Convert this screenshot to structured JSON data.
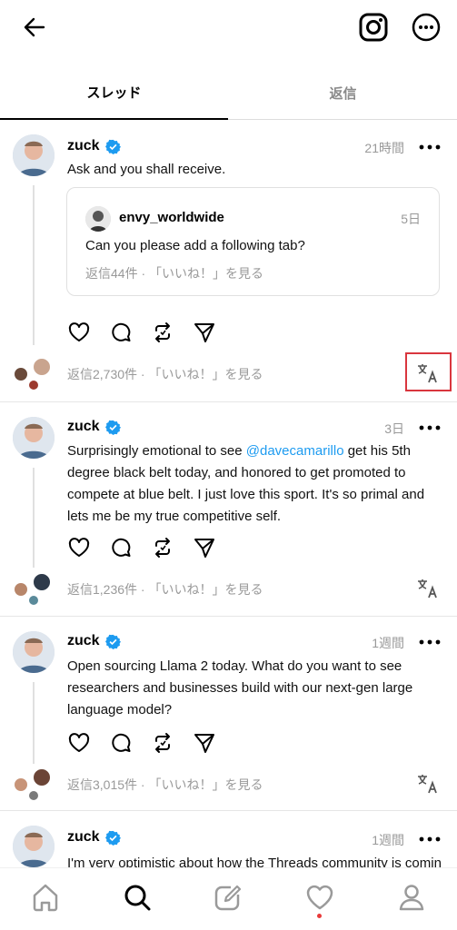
{
  "tabs": [
    {
      "label": "スレッド",
      "active": true
    },
    {
      "label": "返信",
      "active": false
    }
  ],
  "posts": [
    {
      "username": "zuck",
      "time": "21時間",
      "text": "Ask and you shall receive.",
      "quote": {
        "username": "envy_worldwide",
        "time": "5日",
        "text": "Can you please add a following tab?",
        "meta": "返信44件 · 「いいね！」を見る"
      },
      "footer": "返信2,730件 · 「いいね！」を見る"
    },
    {
      "username": "zuck",
      "time": "3日",
      "text_before": "Surprisingly emotional to see ",
      "mention": "@davecamarillo",
      "text_after": " get his 5th degree black belt today, and honored to get promoted to compete at blue belt. I just love this sport. It's so primal and lets me be my true competitive self.",
      "footer": "返信1,236件 · 「いいね！」を見る"
    },
    {
      "username": "zuck",
      "time": "1週間",
      "text": "Open sourcing Llama 2 today. What do you want to see researchers and businesses build with our next-gen large language model?",
      "footer": "返信3,015件 · 「いいね！」を見る"
    },
    {
      "username": "zuck",
      "time": "1週間",
      "text": "I'm very optimistic about how the Threads community is coming"
    }
  ],
  "icons": {
    "back": "arrow-left-icon",
    "instagram": "instagram-icon",
    "more": "more-circle-icon",
    "verified": "verified-badge-icon",
    "translate": "translate-icon"
  },
  "colors": {
    "mention": "#1d9bf0",
    "verified": "#1d9bf0",
    "highlight": "#d9363e",
    "notification_dot": "#e83a3a"
  },
  "nav": [
    "home",
    "search",
    "compose",
    "activity",
    "profile"
  ]
}
